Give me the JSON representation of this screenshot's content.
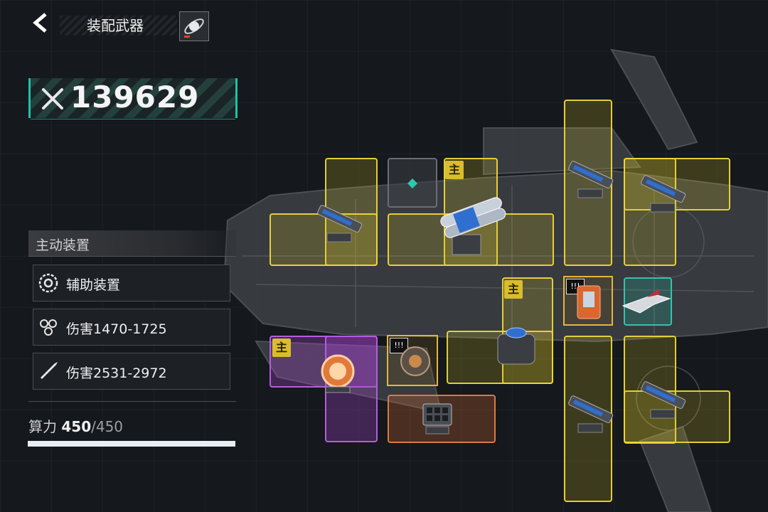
{
  "header": {
    "title": "装配武器",
    "back_icon": "chevron-left-icon",
    "planet_icon": "planet-rocket-icon"
  },
  "power": {
    "value": "139629",
    "icon": "crossed-swords-icon",
    "accent": "#1ec2a7"
  },
  "panel": {
    "title": "主动装置",
    "items": [
      {
        "label": "辅助装置",
        "icon": "gear-target-icon"
      },
      {
        "label": "伤害1470-1725",
        "icon": "drone-swarm-icon"
      },
      {
        "label": "伤害2531-2972",
        "icon": "missile-icon"
      }
    ]
  },
  "compute": {
    "label": "算力",
    "current": "450",
    "max": "/450",
    "fill_fraction": 1.0
  },
  "slots": {
    "badge_main": "主",
    "colors": {
      "yellow": "#ecd636",
      "purple": "#b55ce0",
      "orange": "#d97a45",
      "teal": "#2cc7ad",
      "gray": "#6a6e74"
    },
    "module_label": "!!!"
  }
}
